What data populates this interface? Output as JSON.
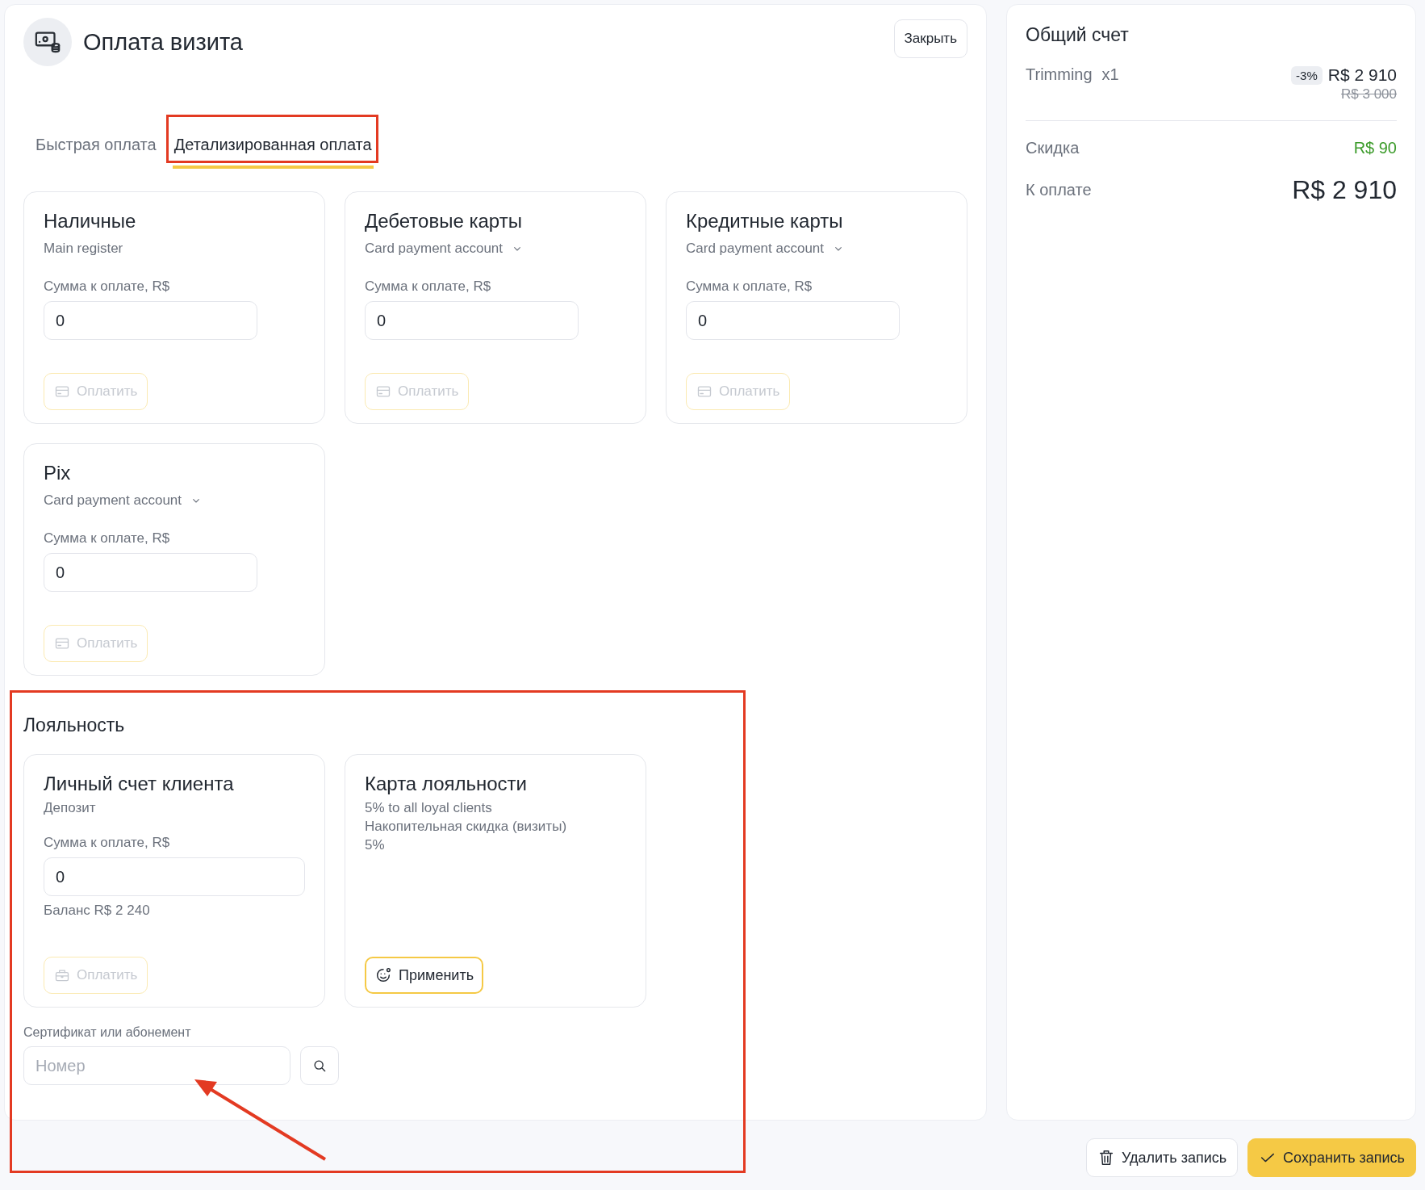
{
  "header": {
    "title": "Оплата визита",
    "close_button": "Закрыть"
  },
  "tabs": [
    {
      "label": "Быстрая оплата",
      "selected": false,
      "highlighted": false
    },
    {
      "label": "Детализированная оплата",
      "selected": true,
      "highlighted": true
    }
  ],
  "payment_methods": [
    {
      "title": "Наличные",
      "account": "Main register",
      "dropdown": false,
      "amount_label": "Сумма к оплате, R$",
      "amount": "0",
      "pay_button": "Оплатить",
      "disabled": true
    },
    {
      "title": "Дебетовые карты",
      "account": "Card payment account",
      "dropdown": true,
      "amount_label": "Сумма к оплате, R$",
      "amount": "0",
      "pay_button": "Оплатить",
      "disabled": true
    },
    {
      "title": "Кредитные карты",
      "account": "Card payment account",
      "dropdown": true,
      "amount_label": "Сумма к оплате, R$",
      "amount": "0",
      "pay_button": "Оплатить",
      "disabled": true
    },
    {
      "title": "Pix",
      "account": "Card payment account",
      "dropdown": true,
      "amount_label": "Сумма к оплате, R$",
      "amount": "0",
      "pay_button": "Оплатить",
      "disabled": true
    }
  ],
  "loyalty": {
    "title": "Лояльность",
    "highlighted": true,
    "cards": [
      {
        "kind": "deposit",
        "title": "Личный счет клиента",
        "subtitle": "Депозит",
        "amount_label": "Сумма к оплате, R$",
        "amount": "0",
        "balance": "Баланс R$ 2 240",
        "pay_button": "Оплатить",
        "disabled": true
      },
      {
        "kind": "loyalty_card",
        "title": "Карта лояльности",
        "lines": [
          "5% to all loyal clients",
          "Накопительная скидка (визиты)",
          "5%"
        ],
        "apply_button": "Применить"
      }
    ],
    "certificate": {
      "label": "Сертификат или абонемент",
      "placeholder": "Номер",
      "pointed": true
    }
  },
  "summary": {
    "title": "Общий счет",
    "items": [
      {
        "name": "Trimming",
        "quantity": "x1",
        "discount_badge": "-3%",
        "price": "R$ 2 910",
        "old_price": "R$ 3 000"
      }
    ],
    "discount_label": "Скидка",
    "discount_value": "R$ 90",
    "total_label": "К оплате",
    "total_value": "R$ 2 910"
  },
  "footer": {
    "delete_button": "Удалить запись",
    "save_button": "Сохранить запись"
  }
}
